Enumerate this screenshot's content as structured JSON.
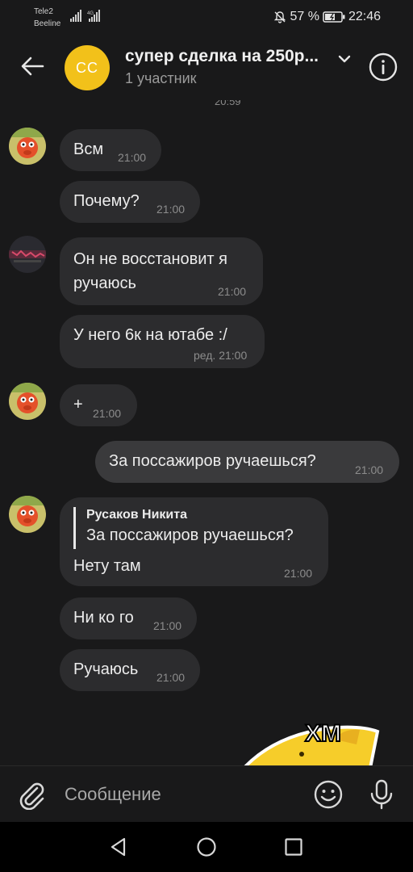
{
  "status": {
    "carrier1": "Tele2",
    "carrier2": "Beeline",
    "network": "4G",
    "battery": "57 %",
    "time": "22:46"
  },
  "header": {
    "avatar_initials": "CC",
    "avatar_color": "#f2c11a",
    "title": "супер сделка на 250р...",
    "subtitle": "1 участник"
  },
  "messages": {
    "top_time": "20:59",
    "m1": {
      "text": "Всм",
      "time": "21:00"
    },
    "m2": {
      "text": "Почему?",
      "time": "21:00"
    },
    "m3": {
      "line1": "Он не восстановит я",
      "line2": "ручаюсь",
      "time": "21:00"
    },
    "m4": {
      "text": "У него 6к на ютабе :/",
      "time": "ред. 21:00"
    },
    "m5": {
      "text": "+",
      "time": "21:00"
    },
    "m6": {
      "text": "За поссажиров ручаешься?",
      "time": "21:00"
    },
    "m7": {
      "reply_author": "Русаков Никита",
      "reply_text": "За поссажиров ручаешься?",
      "text": "Нету там",
      "time": "21:00"
    },
    "m8": {
      "text": "Ни ко го",
      "time": "21:00"
    },
    "m9": {
      "text": "Ручаюсь",
      "time": "21:00"
    },
    "sticker_text": "ХМ"
  },
  "composer": {
    "placeholder": "Сообщение"
  },
  "colors": {
    "background": "#19191a",
    "bubble_incoming": "#2c2c2e",
    "bubble_outgoing": "#3a3a3c",
    "accent": "#f2c11a"
  }
}
